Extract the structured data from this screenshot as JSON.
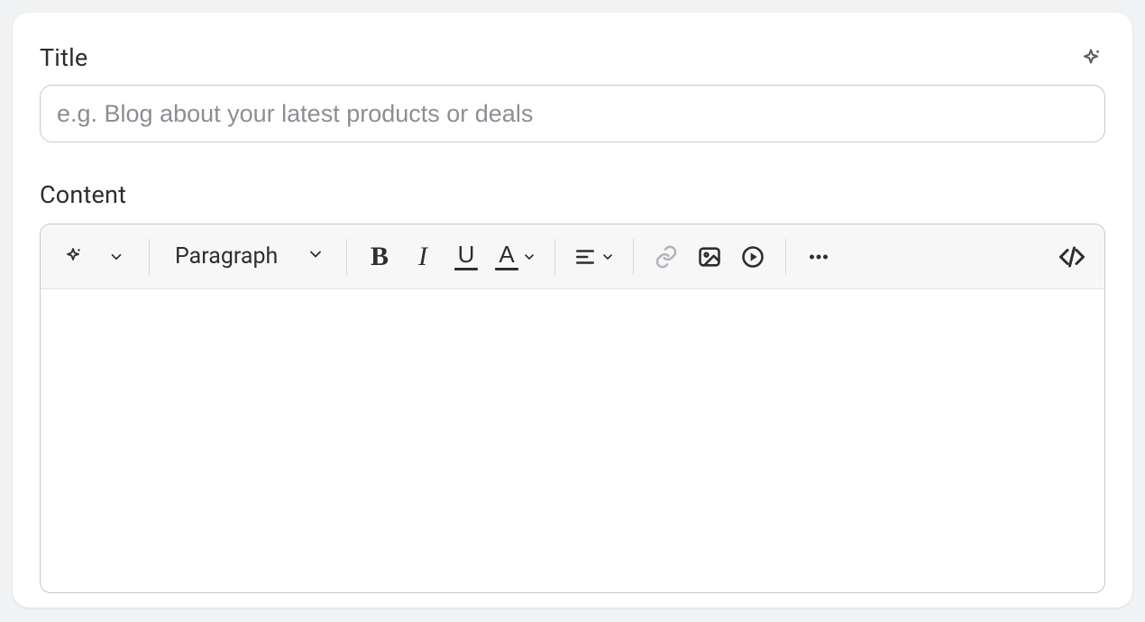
{
  "title": {
    "label": "Title",
    "placeholder": "e.g. Blog about your latest products or deals",
    "value": "",
    "ai_icon": "sparkle-icon"
  },
  "content": {
    "label": "Content",
    "value": ""
  },
  "toolbar": {
    "block_format": "Paragraph",
    "buttons": {
      "ai": "sparkle-icon",
      "ai_dropdown": "chevron-down-icon",
      "bold": "bold-icon",
      "italic": "italic-icon",
      "underline": "underline-icon",
      "text_color": "text-color-icon",
      "text_color_dropdown": "chevron-down-icon",
      "align": "align-left-icon",
      "align_dropdown": "chevron-down-icon",
      "link": "link-icon",
      "image": "image-icon",
      "video": "video-icon",
      "more": "more-horizontal-icon",
      "code_view": "code-icon"
    }
  }
}
